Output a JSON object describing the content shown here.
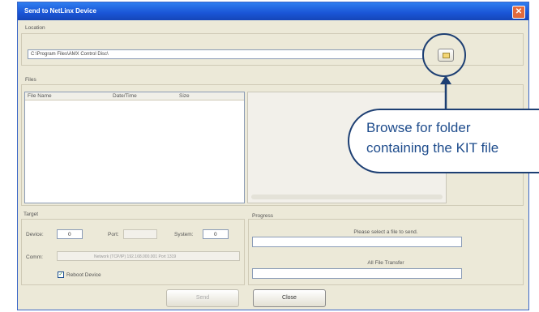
{
  "dialog": {
    "title": "Send to NetLinx Device",
    "close_glyph": "✕"
  },
  "location": {
    "group_label": "Location",
    "path_value": "C:\\Program Files\\AMX Control Disc\\"
  },
  "files": {
    "group_label": "Files",
    "columns": [
      "File Name",
      "Date/Time",
      "Size"
    ]
  },
  "target": {
    "group_label": "Target",
    "device_label": "Device:",
    "device_value": "0",
    "port_label": "Port:",
    "port_value": "",
    "system_label": "System:",
    "system_value": "0",
    "comm_label": "Comm:",
    "comm_value": "Network (TCP/IP) 192.168.000.001 Port 1319",
    "reboot_label": "Reboot Device",
    "reboot_checked": true
  },
  "progress": {
    "group_label": "Progress",
    "status_text": "Please select a file to send.",
    "all_label": "All File Transfer"
  },
  "buttons": {
    "send": "Send",
    "close": "Close"
  },
  "callout": {
    "line1": "Browse for folder",
    "line2": "containing the KIT file"
  },
  "colors": {
    "callout_border": "#1d3f73",
    "callout_text": "#1e4c8c",
    "titlebar": "#1a55d6"
  }
}
